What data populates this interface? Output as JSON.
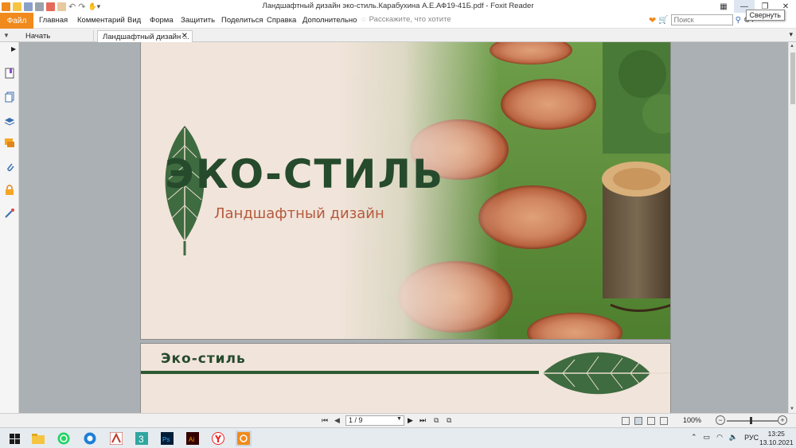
{
  "window": {
    "title": "Ландшафтный дизайн эко-стиль.Карабухина А.Е.АФ19-41Б.pdf - Foxit Reader",
    "tooltip": "Свернуть"
  },
  "menu": {
    "file": "Файл",
    "items": [
      "Главная",
      "Комментарий",
      "Вид",
      "Форма",
      "Защитить",
      "Поделиться",
      "Справка",
      "Дополнительно"
    ],
    "tell_me": "Расскажите, что хотите",
    "search_placeholder": "Поиск"
  },
  "tabs": {
    "start": "Начать",
    "active": "Ландшафтный дизайн ..."
  },
  "left_panel": {
    "icons": [
      "bookmark-icon",
      "pages-icon",
      "layers-icon",
      "comments-icon",
      "attachments-icon",
      "security-icon",
      "signature-icon"
    ]
  },
  "document": {
    "slide1": {
      "brand": "ЭКО-СТИЛЬ",
      "subtitle": "Ландшафтный дизайн"
    },
    "slide2": {
      "brand": "Эко-стиль"
    }
  },
  "statusbar": {
    "page": "1 / 9",
    "zoom": "100%"
  },
  "taskbar": {
    "apps": [
      "file-explorer",
      "whatsapp",
      "browser",
      "acrobat",
      "app-3",
      "photoshop",
      "illustrator",
      "yandex-browser",
      "foxit-reader"
    ],
    "lang": "РУС",
    "time": "13:25",
    "date": "13.10.2021"
  },
  "colors": {
    "accent": "#f08a1c",
    "brand_green": "#264a2c",
    "subtitle_red": "#b55a3d",
    "page_bg": "#f1e4da"
  }
}
